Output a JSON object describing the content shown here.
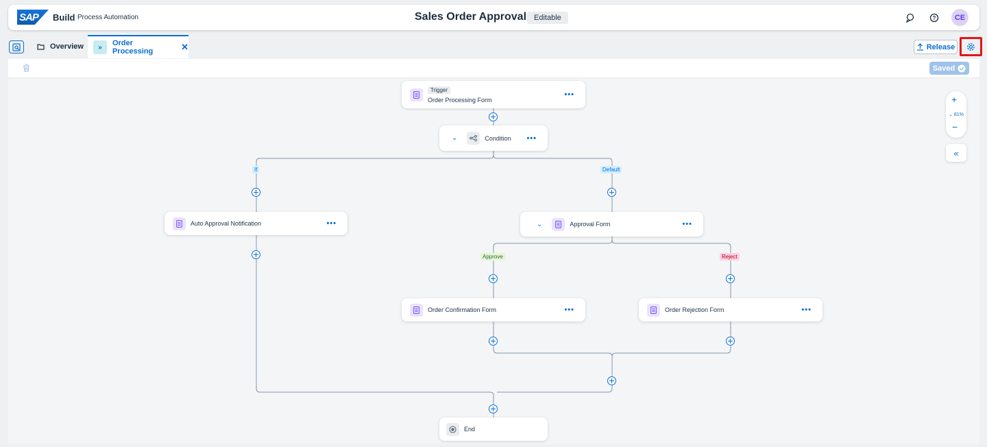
{
  "shell": {
    "logo": "SAP",
    "product": "Build",
    "subproduct": "Process Automation",
    "title": "Sales Order Approval",
    "status_badge": "Editable",
    "avatar": "CE"
  },
  "tabs": {
    "overview_label": "Overview",
    "active_label": "Order Processing"
  },
  "toolbar": {
    "release_label": "Release",
    "saved_label": "Saved"
  },
  "zoom": {
    "level": "81%"
  },
  "nodes": {
    "trigger": {
      "chip": "Trigger",
      "label": "Order Processing Form"
    },
    "condition": {
      "label": "Condition"
    },
    "auto_approval": {
      "label": "Auto Approval Notification"
    },
    "approval_form": {
      "label": "Approval Form"
    },
    "order_confirmation": {
      "label": "Order Confirmation Form"
    },
    "order_rejection": {
      "label": "Order Rejection Form"
    },
    "end": {
      "label": "End"
    }
  },
  "branches": {
    "if": "If",
    "default": "Default",
    "approve": "Approve",
    "reject": "Reject"
  },
  "colors": {
    "accent": "#0a6ed1",
    "highlight": "#e0161a"
  }
}
